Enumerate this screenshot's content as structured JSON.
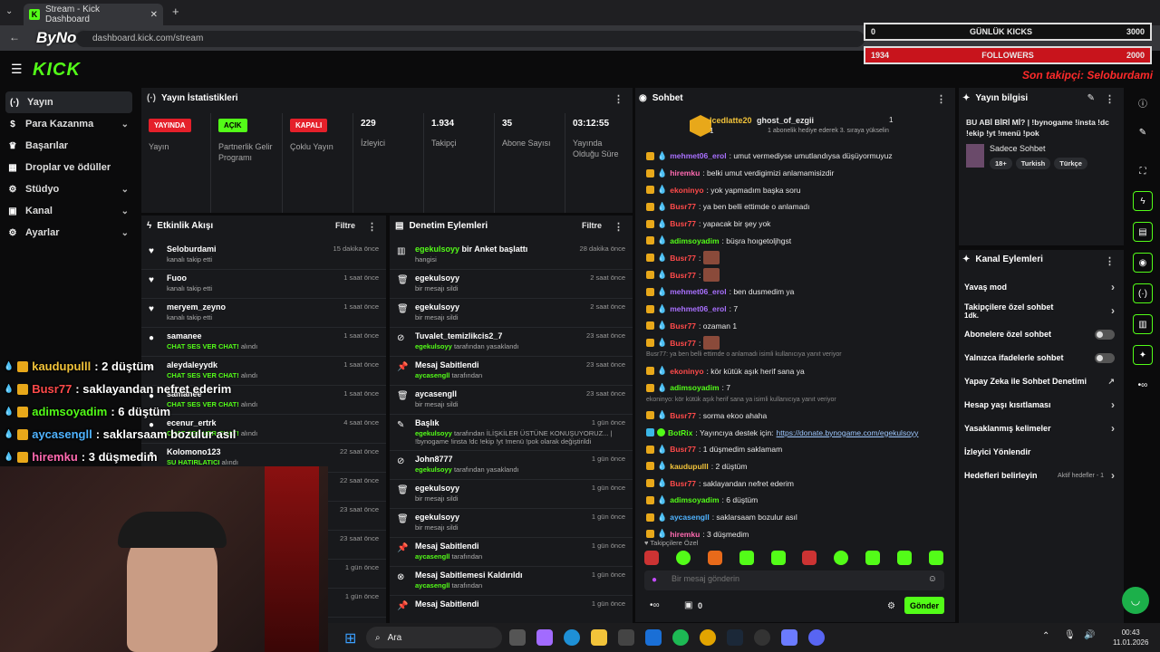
{
  "browser": {
    "tab_title": "Stream - Kick Dashboard",
    "favicon_letter": "K",
    "url": "dashboard.kick.com/stream",
    "watermark": "ByNoGame"
  },
  "kick": {
    "logo": "KICK"
  },
  "overlay": {
    "daily_kicks_label": "GÜNLÜK KICKS",
    "daily_kicks_value": "0",
    "daily_kicks_goal": "3000",
    "followers_label": "FOLLOWERS",
    "followers_value": "1934",
    "followers_goal": "2000",
    "last_follower": "Son takipçi: Seloburdami",
    "chat_overlay": [
      {
        "name": "kaudupulll",
        "msg": ": 2 düştüm",
        "color": "#f2c33a"
      },
      {
        "name": "Busr77",
        "msg": ": saklayandan nefret ederim",
        "color": "#ff4a4a"
      },
      {
        "name": "adimsoyadim",
        "msg": ": 6 düştüm",
        "color": "#53fc18"
      },
      {
        "name": "aycasengll",
        "msg": ": saklarsaam bozulur asıl",
        "color": "#4fb3ff"
      },
      {
        "name": "hiremku",
        "msg": ": 3 düşmedim",
        "color": "#ff6ab0"
      }
    ]
  },
  "sidebar": {
    "items": [
      {
        "label": "Yayın",
        "icon": "(·)"
      },
      {
        "label": "Para Kazanma",
        "icon": "$"
      },
      {
        "label": "Başarılar",
        "icon": "♛"
      },
      {
        "label": "Droplar ve ödüller",
        "icon": "▦"
      },
      {
        "label": "Stüdyo",
        "icon": "⚙"
      },
      {
        "label": "Kanal",
        "icon": "▣"
      },
      {
        "label": "Ayarlar",
        "icon": "⚙"
      }
    ]
  },
  "stats": {
    "title": "Yayın İstatistikleri",
    "items": [
      {
        "badge": "YAYINDA",
        "label": "Yayın"
      },
      {
        "badge": "AÇIK",
        "label": "Partnerlik Gelir Programı"
      },
      {
        "badge": "KAPALI",
        "label": "Çoklu Yayın"
      },
      {
        "value": "229",
        "label": "İzleyici"
      },
      {
        "value": "1.934",
        "label": "Takipçi"
      },
      {
        "value": "35",
        "label": "Abone Sayısı"
      },
      {
        "value": "03:12:55",
        "label": "Yayında Olduğu Süre"
      }
    ]
  },
  "activity": {
    "title": "Etkinlik Akışı",
    "filter": "Filtre",
    "rows": [
      {
        "name": "Seloburdami",
        "sub": "kanalı takip etti",
        "time": "15 dakika önce"
      },
      {
        "name": "Fuoo",
        "sub": "kanalı takip etti",
        "time": "1 saat önce"
      },
      {
        "name": "meryem_zeyno",
        "sub": "kanalı takip etti",
        "time": "1 saat önce"
      },
      {
        "name": "samanee",
        "sub_g": "CHAT SES VER CHAT!",
        "sub": " alındı",
        "time": "1 saat önce"
      },
      {
        "name": "aleydaleyydk",
        "sub_g": "CHAT SES VER CHAT!",
        "sub": " alındı",
        "time": "1 saat önce"
      },
      {
        "name": "samanee",
        "sub_g": "CHAT SES VER CHAT!",
        "sub": " alındı",
        "time": "1 saat önce"
      },
      {
        "name": "ecenur_ertrk",
        "sub_g": "CHAT SES VER CHAT!",
        "sub": " alındı",
        "time": "4 saat önce"
      },
      {
        "name": "Kolomono123",
        "sub_g": "SU HATIRLATICI",
        "sub": " alındı",
        "time": "22 saat önce"
      },
      {
        "name": "",
        "sub": "",
        "time": "22 saat önce"
      },
      {
        "name": "",
        "sub": "",
        "time": "23 saat önce"
      },
      {
        "name": "",
        "sub": "",
        "time": "23 saat önce"
      },
      {
        "name": "",
        "sub": "",
        "time": "1 gün önce"
      },
      {
        "name": "",
        "sub": "",
        "time": "1 gün önce"
      }
    ]
  },
  "moderation": {
    "title": "Denetim Eylemleri",
    "filter": "Filtre",
    "rows": [
      {
        "icon": "▥",
        "name_g": "egekulsoyy",
        "name": " bir Anket başlattı",
        "sub": "hangisi",
        "time": "28 dakika önce"
      },
      {
        "icon": "🗑",
        "name": "egekulsoyy",
        "sub": "bir mesajı sildi",
        "time": "2 saat önce"
      },
      {
        "icon": "🗑",
        "name": "egekulsoyy",
        "sub": "bir mesajı sildi",
        "time": "2 saat önce"
      },
      {
        "icon": "⊘",
        "name": "Tuvalet_temizlikcis2_7",
        "sub_g": "egekulsoyy",
        "sub": " tarafından yasaklandı",
        "time": "23 saat önce"
      },
      {
        "icon": "📌",
        "name": "Mesaj Sabitlendi",
        "sub_g": "aycasengll",
        "sub": " tarafından",
        "time": "23 saat önce"
      },
      {
        "icon": "🗑",
        "name": "aycasengll",
        "sub": "bir mesajı sildi",
        "time": "23 saat önce"
      },
      {
        "icon": "✎",
        "name": "Başlık",
        "sub_g": "egekulsoyy",
        "sub": " tarafından İLİŞKİLER ÜSTÜNE KONUŞUYORUZ... | !bynogame !insta !dc !ekip !yt !menü !pok olarak değiştirildi",
        "time": "1 gün önce"
      },
      {
        "icon": "⊘",
        "name": "John8777",
        "sub_g": "egekulsoyy",
        "sub": " tarafından yasaklandı",
        "time": "1 gün önce"
      },
      {
        "icon": "🗑",
        "name": "egekulsoyy",
        "sub": "bir mesajı sildi",
        "time": "1 gün önce"
      },
      {
        "icon": "🗑",
        "name": "egekulsoyy",
        "sub": "bir mesajı sildi",
        "time": "1 gün önce"
      },
      {
        "icon": "📌",
        "name": "Mesaj Sabitlendi",
        "sub_g": "aycasengll",
        "sub": " tarafından",
        "time": "1 gün önce"
      },
      {
        "icon": "⊗",
        "name": "Mesaj Sabitlemesi Kaldırıldı",
        "sub_g": "aycasengll",
        "sub": " tarafından",
        "time": "1 gün önce"
      },
      {
        "icon": "📌",
        "name": "Mesaj Sabitlendi",
        "sub": "",
        "time": "1 gün önce"
      }
    ]
  },
  "chat": {
    "title": "Sohbet",
    "gifter": "Icedlatte20",
    "gifter_count": "1",
    "gift_target": "ghost_of_ezgii",
    "gift_target_count": "1",
    "gift_note": "1 abonelik hediye ederek 3. sıraya yükselin",
    "lines": [
      {
        "type": "msg",
        "name": "mehmet06_erol",
        "color": "#a970ff",
        "text": ": umut vermediyse umutlandıysa düşüyormuyuz"
      },
      {
        "type": "msg",
        "name": "hiremku",
        "color": "#ff6ab0",
        "text": ": belki umut verdigimizi anlamamisizdir"
      },
      {
        "type": "msg",
        "name": "ekoninyo",
        "color": "#ff4a4a",
        "text": ": yok yapmadım başka soru"
      },
      {
        "type": "msg",
        "name": "Busr77",
        "color": "#ff4a4a",
        "text": ": ya ben belli ettimde o anlamadı"
      },
      {
        "type": "msg",
        "name": "Busr77",
        "color": "#ff4a4a",
        "text": ": yapacak bir şey yok"
      },
      {
        "type": "msg",
        "name": "adimsoyadim",
        "color": "#53fc18",
        "text": ": büşra hoıgetoljhgst"
      },
      {
        "type": "emote",
        "name": "Busr77",
        "color": "#ff4a4a",
        "text": ":"
      },
      {
        "type": "emote",
        "name": "Busr77",
        "color": "#ff4a4a",
        "text": ":"
      },
      {
        "type": "msg",
        "name": "mehmet06_erol",
        "color": "#a970ff",
        "text": ": ben dusmedim ya"
      },
      {
        "type": "msg",
        "name": "mehmet06_erol",
        "color": "#a970ff",
        "text": ": 7"
      },
      {
        "type": "msg",
        "name": "Busr77",
        "color": "#ff4a4a",
        "text": ": ozaman 1"
      },
      {
        "type": "emote",
        "name": "Busr77",
        "color": "#ff4a4a",
        "text": ":"
      },
      {
        "type": "reply",
        "text": "Busr77: ya ben belli ettimde o anlamadı isimli kullanıcıya yanıt veriyor"
      },
      {
        "type": "msg",
        "name": "ekoninyo",
        "color": "#ff4a4a",
        "text": ": kör kütük aşık herif sana ya"
      },
      {
        "type": "msg",
        "name": "adimsoyadim",
        "color": "#53fc18",
        "text": ": 7"
      },
      {
        "type": "reply",
        "text": "ekoninyo: kör kütük aşık herif sana ya isimli kullanıcıya yanıt veriyor"
      },
      {
        "type": "msg",
        "name": "Busr77",
        "color": "#ff4a4a",
        "text": ": sorma ekoo ahaha"
      },
      {
        "type": "bot",
        "name": "BotRix",
        "color": "#53fc18",
        "text": ": Yayıncıya destek için: ",
        "link": "https://donate.bynogame.com/egekulsoyy"
      },
      {
        "type": "msg",
        "name": "Busr77",
        "color": "#ff4a4a",
        "text": ": 1 düşmedim saklamam"
      },
      {
        "type": "msg",
        "name": "kaudupulll",
        "color": "#f2c33a",
        "text": ": 2 düştüm"
      },
      {
        "type": "msg",
        "name": "Busr77",
        "color": "#ff4a4a",
        "text": ": saklayandan nefret ederim"
      },
      {
        "type": "msg",
        "name": "adimsoyadim",
        "color": "#53fc18",
        "text": ": 6 düştüm"
      },
      {
        "type": "msg",
        "name": "aycasengll",
        "color": "#4fb3ff",
        "text": ": saklarsaam bozulur asıl"
      },
      {
        "type": "msg",
        "name": "hiremku",
        "color": "#ff6ab0",
        "text": ": 3 düşmedim"
      }
    ],
    "followers_only": "Takipçilere Özel",
    "input_placeholder": "Bir mesaj gönderin",
    "points": "0",
    "send": "Gönder"
  },
  "stream_info": {
    "title": "Yayın bilgisi",
    "stream_title": "BU ABİ BİRİ Mİ? | !bynogame !insta !dc !ekip !yt !menü !pok",
    "category": "Sadece Sohbet",
    "tags": [
      "18+",
      "Turkish",
      "Türkçe"
    ]
  },
  "channel_actions": {
    "title": "Kanal Eylemleri",
    "items": [
      {
        "label": "Yavaş mod",
        "ctl": "arrow"
      },
      {
        "label": "Takipçilere özel sohbet",
        "sub": "1dk.",
        "ctl": "arrow"
      },
      {
        "label": "Abonelere özel sohbet",
        "ctl": "toggle"
      },
      {
        "label": "Yalnızca ifadelerle sohbet",
        "ctl": "toggle"
      },
      {
        "label": "Yapay Zeka ile Sohbet Denetimi",
        "ctl": "ext"
      },
      {
        "label": "Hesap yaşı kısıtlaması",
        "ctl": "arrow"
      },
      {
        "label": "Yasaklanmış kelimeler",
        "ctl": "arrow"
      },
      {
        "label": "İzleyici Yönlendir",
        "ctl": "none"
      },
      {
        "label": "Hedefleri belirleyin",
        "ctl": "arrow",
        "note": "Aktif hedefler - 1"
      }
    ]
  },
  "taskbar": {
    "search": "Ara",
    "time": "00:43",
    "date": "11.01.2026"
  },
  "colors": {
    "accent": "#53fc18",
    "live_red": "#e5202a",
    "panel": "#18191c"
  }
}
